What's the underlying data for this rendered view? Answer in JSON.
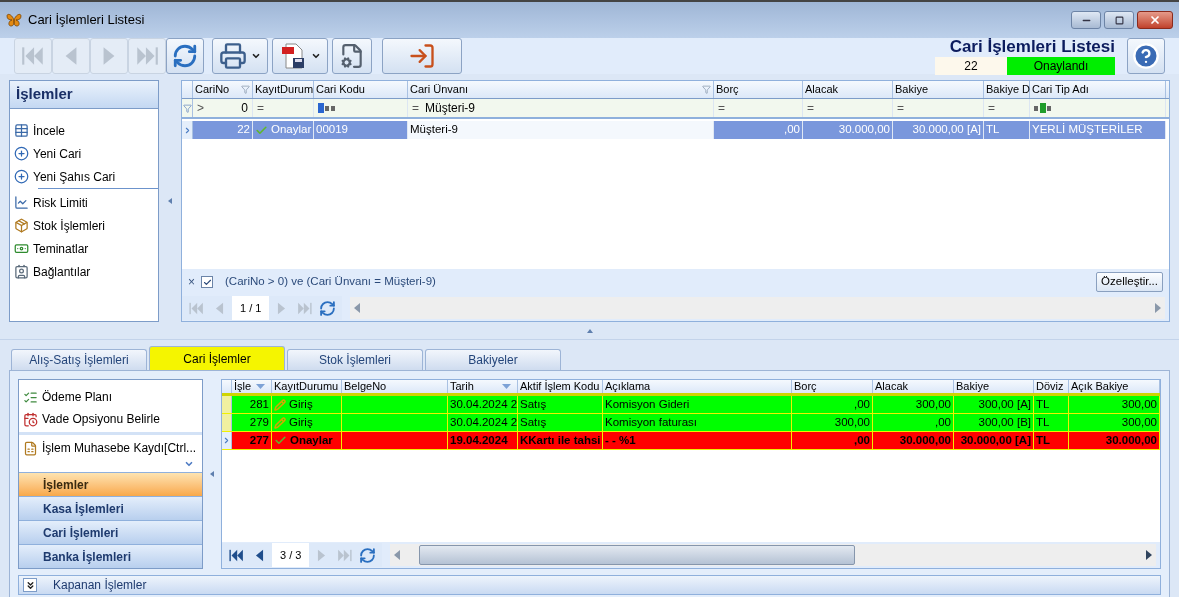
{
  "window": {
    "title": "Cari İşlemleri Listesi"
  },
  "toolbar": {
    "buttons": [
      {
        "kind": "first",
        "disabled": true
      },
      {
        "kind": "prev",
        "disabled": true
      },
      {
        "kind": "next",
        "disabled": true
      },
      {
        "kind": "last",
        "disabled": true
      },
      {
        "kind": "refresh",
        "disabled": false
      },
      {
        "kind": "print",
        "disabled": false,
        "dropdown": true
      },
      {
        "kind": "pdf",
        "disabled": false,
        "dropdown": true
      },
      {
        "kind": "settings",
        "disabled": false
      },
      {
        "kind": "exit",
        "disabled": false
      }
    ]
  },
  "header": {
    "title": "Cari İşlemleri Listesi",
    "record_no": "22",
    "status": "Onaylandı"
  },
  "left_panel": {
    "title": "İşlemler",
    "groups": [
      [
        {
          "label": "İncele",
          "kind": "table"
        },
        {
          "label": "Yeni Cari",
          "kind": "add"
        },
        {
          "label": "Yeni Şahıs Cari",
          "kind": "add"
        }
      ],
      [
        {
          "label": "Risk Limiti",
          "kind": "chart"
        },
        {
          "label": "Stok İşlemleri",
          "kind": "package"
        },
        {
          "label": "Teminatlar",
          "kind": "money"
        },
        {
          "label": "Bağlantılar",
          "kind": "contact"
        }
      ]
    ]
  },
  "top_grid": {
    "columns": [
      {
        "label": "CariNo",
        "filter": true
      },
      {
        "label": "KayıtDurum"
      },
      {
        "label": "Cari Kodu"
      },
      {
        "label": "Cari Ünvanı",
        "filter": true
      },
      {
        "label": "Borç"
      },
      {
        "label": "Alacak"
      },
      {
        "label": "Bakiye"
      },
      {
        "label": "Bakiye D"
      },
      {
        "label": "Cari Tip Adı"
      }
    ],
    "filter_row": [
      {
        "kind": "op",
        "symbol": ">",
        "value": "0"
      },
      {
        "kind": "op",
        "symbol": "="
      },
      {
        "kind": "abc"
      },
      {
        "kind": "op",
        "symbol": "=",
        "value": "Müşteri-9"
      },
      {
        "kind": "op",
        "symbol": "="
      },
      {
        "kind": "op",
        "symbol": "="
      },
      {
        "kind": "op",
        "symbol": "="
      },
      {
        "kind": "op",
        "symbol": "="
      },
      {
        "kind": "abc"
      }
    ],
    "rows": [
      {
        "selected": true,
        "kind": "approved",
        "cells": [
          "22",
          "Onaylar",
          "00019",
          "Müşteri-9",
          ",00",
          "30.000,00",
          "30.000,00 [A]",
          "TL",
          "YERLİ MÜŞTERİLER"
        ]
      }
    ],
    "filter_bar": {
      "clear": "×",
      "enabled": true,
      "expression": "(CariNo > 0) ve (Cari Ünvanı = Müşteri-9)",
      "customize": "Özelleştir..."
    },
    "pager": {
      "page": "1 / 1",
      "buttons": [
        {
          "kind": "first",
          "disabled": true
        },
        {
          "kind": "prev",
          "disabled": true
        },
        {
          "kind": "next",
          "disabled": true
        },
        {
          "kind": "last",
          "disabled": true
        },
        {
          "kind": "refresh",
          "disabled": false
        }
      ]
    }
  },
  "tabs": [
    {
      "label": "Alış-Satış İşlemleri",
      "selected": false
    },
    {
      "label": "Cari İşlemler",
      "selected": true
    },
    {
      "label": "Stok İşlemleri",
      "selected": false
    },
    {
      "label": "Bakiyeler",
      "selected": false
    }
  ],
  "bottom_left": {
    "groups": [
      [
        {
          "label": "Ödeme Planı",
          "kind": "plan"
        },
        {
          "label": "Vade Opsiyonu Belirle",
          "kind": "calendar"
        }
      ],
      [
        {
          "label": "İşlem Muhasebe Kaydı[Ctrl...",
          "kind": "ledger"
        }
      ]
    ],
    "nav": [
      {
        "label": "İşlemler",
        "selected": true
      },
      {
        "label": "Kasa İşlemleri",
        "selected": false
      },
      {
        "label": "Cari İşlemleri",
        "selected": false
      },
      {
        "label": "Banka İşlemleri",
        "selected": false
      }
    ]
  },
  "bottom_grid": {
    "columns": [
      {
        "label": "İşle",
        "sorted": true
      },
      {
        "label": "KayıtDurumu"
      },
      {
        "label": "BelgeNo"
      },
      {
        "label": "Tarih",
        "sorted": true
      },
      {
        "label": "Aktif İşlem Kodu"
      },
      {
        "label": "Açıklama"
      },
      {
        "label": "Borç"
      },
      {
        "label": "Alacak"
      },
      {
        "label": "Bakiye"
      },
      {
        "label": "Döviz"
      },
      {
        "label": "Açık Bakiye"
      }
    ],
    "rows": [
      {
        "color": "#00ff00",
        "bold": false,
        "focused": false,
        "kind": "entry",
        "cells": [
          "281",
          "Giriş",
          "",
          "30.04.2024 2",
          "Satış",
          "Komisyon Gideri",
          ",00",
          "300,00",
          "300,00 [A]",
          "TL",
          "300,00"
        ]
      },
      {
        "color": "#00ff00",
        "bold": false,
        "focused": false,
        "kind": "entry",
        "cells": [
          "279",
          "Giriş",
          "",
          "30.04.2024 2",
          "Satış",
          "Komisyon faturası",
          "300,00",
          ",00",
          "300,00 [B]",
          "TL",
          "300,00"
        ]
      },
      {
        "color": "#ff0000",
        "bold": true,
        "focused": true,
        "kind": "approved",
        "cells": [
          "277",
          "Onaylar",
          "",
          "19.04.2024",
          "KKartı ile tahsi",
          "-  - %1",
          ",00",
          "30.000,00",
          "30.000,00 [A]",
          "TL",
          "30.000,00"
        ]
      }
    ],
    "pager": {
      "page": "3 / 3",
      "buttons": [
        {
          "kind": "first",
          "disabled": false
        },
        {
          "kind": "prev",
          "disabled": false
        },
        {
          "kind": "next",
          "disabled": true
        },
        {
          "kind": "last",
          "disabled": true
        },
        {
          "kind": "refresh",
          "disabled": false
        }
      ]
    }
  },
  "collapsed_panel": {
    "label": "Kapanan İşlemler",
    "expanded": false
  }
}
